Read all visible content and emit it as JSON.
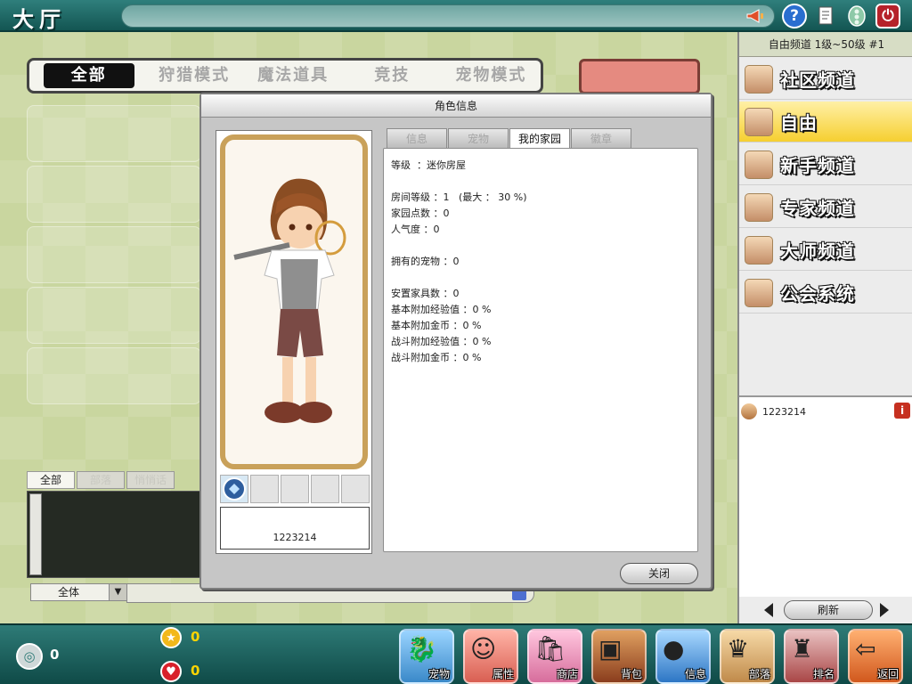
{
  "top_bar": {
    "title": "大厅",
    "icons": [
      "megaphone-icon",
      "help-icon",
      "document-icon",
      "gem-icon",
      "power-icon"
    ]
  },
  "mode_tabs": [
    "全部",
    "狩猎模式",
    "魔法道具",
    "竞技",
    "宠物模式"
  ],
  "chat": {
    "tabs": [
      "全部",
      "部落",
      "悄悄话"
    ],
    "scope": "全体",
    "send_icon": "keyboard-icon"
  },
  "right_panel": {
    "header": "自由频道 1级~50级 #1",
    "channels": [
      {
        "label": "社区频道",
        "active": false
      },
      {
        "label": "自由",
        "active": true
      },
      {
        "label": "新手频道",
        "active": false
      },
      {
        "label": "专家频道",
        "active": false
      },
      {
        "label": "大师频道",
        "active": false
      },
      {
        "label": "公会系统",
        "active": false
      }
    ],
    "users": [
      {
        "name": "1223214"
      }
    ],
    "refresh": "刷新"
  },
  "bottom_bar": {
    "coins": "0",
    "gold": "0",
    "hearts": "0",
    "menu": [
      {
        "label": "宠物",
        "icon": "pet-icon"
      },
      {
        "label": "属性",
        "icon": "attributes-icon"
      },
      {
        "label": "商店",
        "icon": "shop-icon"
      },
      {
        "label": "背包",
        "icon": "backpack-icon"
      },
      {
        "label": "信息",
        "icon": "info-icon"
      },
      {
        "label": "部落",
        "icon": "tribe-icon"
      },
      {
        "label": "排名",
        "icon": "ranking-icon"
      },
      {
        "label": "返回",
        "icon": "exit-icon"
      }
    ]
  },
  "dialog": {
    "title": "角色信息",
    "tabs": [
      {
        "label": "信息",
        "active": false
      },
      {
        "label": "宠物",
        "active": false
      },
      {
        "label": "我的家园",
        "active": true
      },
      {
        "label": "徽章",
        "active": false
      }
    ],
    "player_name": "1223214",
    "info_lines": [
      "等级  ：迷你房屋",
      "",
      "房间等级 ：1   (最大 ： 30 %)",
      "家园点数 ：0",
      "人气度 ：0",
      "",
      "拥有的宠物 ：0",
      "",
      "安置家具数 ：0",
      "基本附加经验值 ：0 %",
      "基本附加金币 ：0 %",
      "战斗附加经验值 ：0 %",
      "战斗附加金币 ：0 %"
    ],
    "close": "关闭"
  },
  "colors": {
    "teal_bar": "#135552",
    "active_channel": "#f6cf30",
    "stat_yellow": "#ffd400"
  }
}
